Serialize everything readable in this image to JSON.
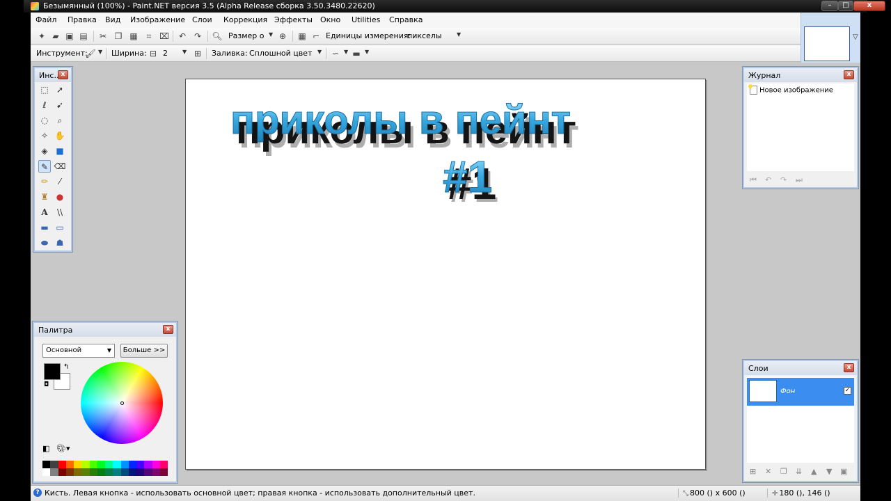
{
  "window": {
    "title": "Безымянный (100%) - Paint.NET версия 3.5 (Alpha Release сборка 3.50.3480.22620)",
    "min": "–",
    "max": "□",
    "close": "x"
  },
  "menu": [
    "Файл",
    "Правка",
    "Вид",
    "Изображение",
    "Слои",
    "Коррекция",
    "Эффекты",
    "Окно",
    "Utilities",
    "Справка"
  ],
  "toolbar1": {
    "zoom_label": "Размер о",
    "units_label": "Единицы измерения:",
    "units_value": "пикселы"
  },
  "toolbar2": {
    "tool_label": "Инструмент:",
    "width_label": "Ширина:",
    "width_value": "2",
    "fill_label": "Заливка:",
    "fill_value": "Сплошной цвет"
  },
  "canvas": {
    "line1": "приколы в пейнт",
    "line2": "#1",
    "text_color": "#3aa9e0",
    "shadow_color": "#1a1a1a"
  },
  "tools_panel": {
    "title": "Инс...",
    "icons": [
      "rect-select-icon",
      "move-selection-icon",
      "lasso-select-icon",
      "move-selected-icon",
      "ellipse-select-icon",
      "zoom-icon",
      "magic-wand-icon",
      "pan-icon",
      "paint-bucket-icon",
      "gradient-icon",
      "paintbrush-icon",
      "eraser-icon",
      "pencil-icon",
      "color-picker-icon",
      "clone-stamp-icon",
      "recolor-icon",
      "text-icon",
      "line-curve-icon",
      "rectangle-icon",
      "rounded-rectangle-icon",
      "ellipse-icon",
      "freeform-shape-icon"
    ]
  },
  "history_panel": {
    "title": "Журнал",
    "entry": "Новое изображение"
  },
  "palette_panel": {
    "title": "Палитра",
    "mode": "Основной",
    "more_button": "Больше >>",
    "primary_color": "#000000",
    "secondary_color": "#ffffff",
    "swatches": [
      "#000000",
      "#404040",
      "#ff0000",
      "#ff6a00",
      "#ffd800",
      "#b6ff00",
      "#4cff00",
      "#00ff21",
      "#00ff90",
      "#00ffff",
      "#0094ff",
      "#0026ff",
      "#4800ff",
      "#b200ff",
      "#ff00dc",
      "#ff006e",
      "#ffffff",
      "#808080",
      "#7f0000",
      "#7f3300",
      "#7f6a00",
      "#5b7f00",
      "#267f00",
      "#007f0e",
      "#007f46",
      "#007f7f",
      "#004a7f",
      "#00137f",
      "#21007f",
      "#57007f",
      "#7f006e",
      "#7f0037"
    ]
  },
  "layers_panel": {
    "title": "Слои",
    "layer_name": "Фон",
    "visible_check": "✓"
  },
  "status": {
    "message": "Кисть. Левая кнопка - использовать основной цвет; правая кнопка - использовать дополнительный цвет.",
    "image_size": "800 () x 600 ()",
    "cursor_pos": "180 (), 146 ()"
  }
}
